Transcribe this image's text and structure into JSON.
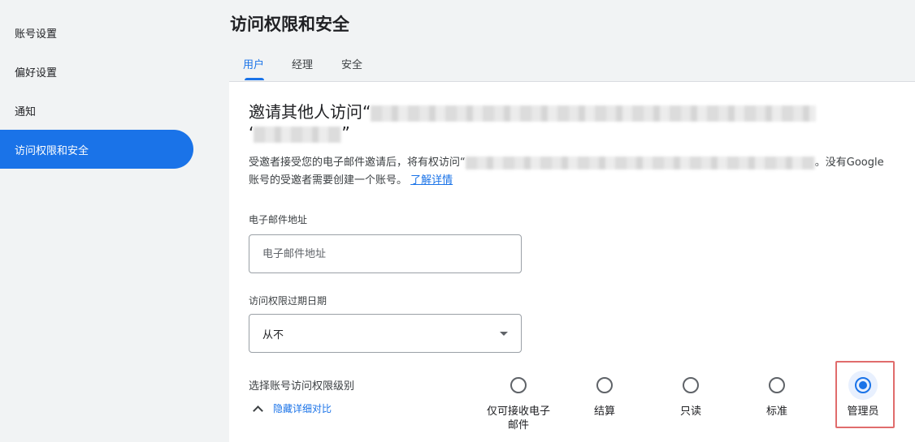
{
  "sidebar": {
    "items": [
      {
        "label": "账号设置"
      },
      {
        "label": "偏好设置"
      },
      {
        "label": "通知"
      },
      {
        "label": "访问权限和安全"
      }
    ]
  },
  "header": {
    "title": "访问权限和安全",
    "tabs": [
      {
        "label": "用户"
      },
      {
        "label": "经理"
      },
      {
        "label": "安全"
      }
    ]
  },
  "invite": {
    "title_prefix": "邀请其他人访问“",
    "title_line2_prefix": "‘",
    "title_suffix": "”",
    "desc_prefix": "受邀者接受您的电子邮件邀请后，将有权访问“",
    "desc_suffix": "。没有Google 账号的受邀者需要创建一个账号。",
    "learn_more": "了解详情"
  },
  "email": {
    "label": "电子邮件地址",
    "placeholder": "电子邮件地址"
  },
  "expiry": {
    "label": "访问权限过期日期",
    "value": "从不"
  },
  "access_level": {
    "label": "选择账号访问权限级别",
    "toggle_label": "隐藏详细对比",
    "options": [
      {
        "label": "仅可接收电子邮件",
        "checked": false
      },
      {
        "label": "结算",
        "checked": false
      },
      {
        "label": "只读",
        "checked": false
      },
      {
        "label": "标准",
        "checked": false
      },
      {
        "label": "管理员",
        "checked": true
      }
    ]
  },
  "colors": {
    "accent": "#1a73e8",
    "highlight_border": "#e06c6c"
  }
}
